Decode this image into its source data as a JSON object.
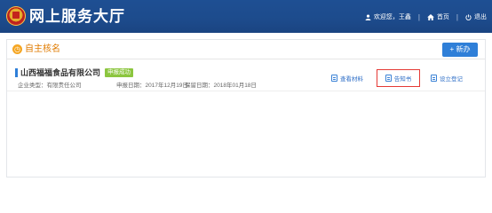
{
  "header": {
    "title": "网上服务大厅",
    "nav": [
      {
        "icon": "user-icon",
        "label": "欢迎您，王鑫"
      },
      {
        "icon": "home-icon",
        "label": "首页"
      },
      {
        "icon": "power-icon",
        "label": "退出"
      }
    ],
    "colors": {
      "bar": "#1d4b8c",
      "text": "#ffffff"
    }
  },
  "panel": {
    "title": "自主核名",
    "add_label": "+ 新办",
    "accent": "#e07b00"
  },
  "records": [
    {
      "company": "山西福福食品有限公司",
      "status": "申报成功",
      "type_text": "企业类型：有限责任公司",
      "apply_text": "申报日期：2017年12月19日",
      "reserve_text": "保留日期：2018年01月18日",
      "actions": [
        "查看材料",
        "告知书",
        "设立登记"
      ]
    }
  ]
}
